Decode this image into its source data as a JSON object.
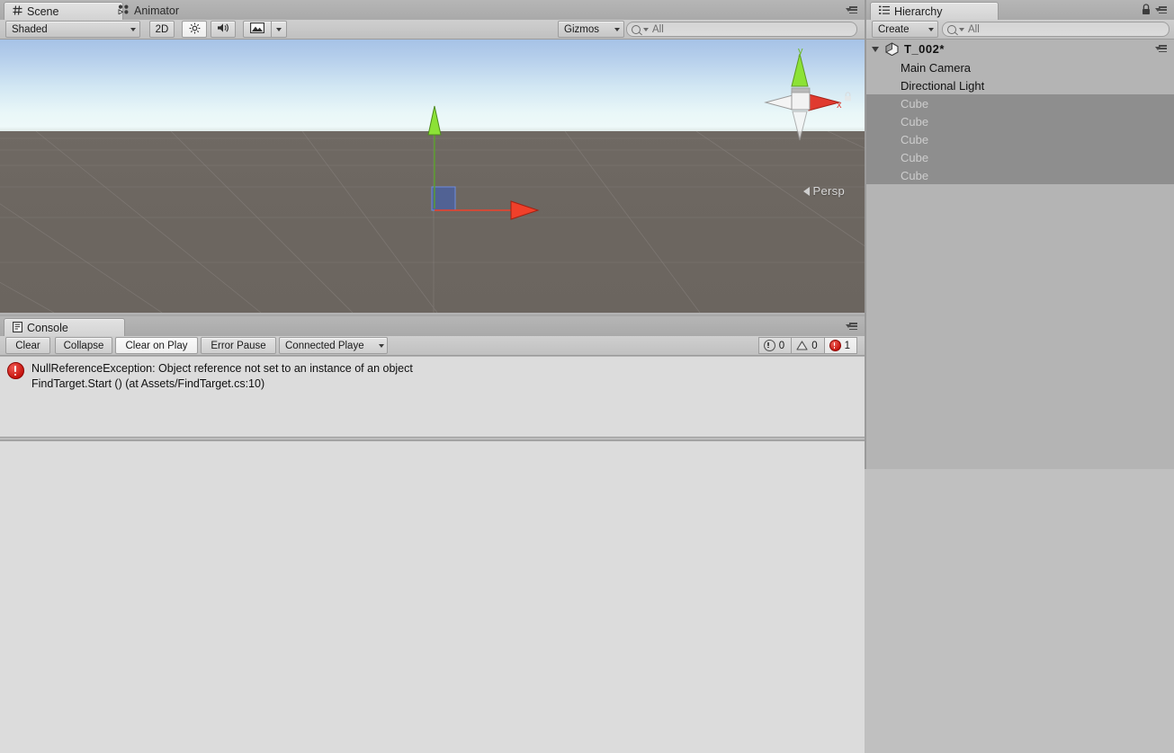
{
  "scene_panel": {
    "tabs": [
      {
        "label": "Scene",
        "icon": "grid-hash-icon",
        "active": true
      },
      {
        "label": "Animator",
        "icon": "animator-icon",
        "active": false
      }
    ],
    "toolbar": {
      "draw_mode": "Shaded",
      "two_d_label": "2D",
      "lighting_icon": "sun-icon",
      "audio_icon": "speaker-icon",
      "effects_icon": "image-icon",
      "gizmos_label": "Gizmos",
      "search_placeholder": "All",
      "search_value": "All",
      "menu_icon": "panel-menu-icon"
    },
    "viewport": {
      "camera_mode": "Persp",
      "gizmo_axes": [
        {
          "axis": "y",
          "label": "y",
          "color": "#7ed320"
        },
        {
          "axis": "x",
          "label": "x",
          "color": "#e03a2f"
        },
        {
          "axis": "z",
          "label": "",
          "color": "#e8e8e8"
        }
      ],
      "lock_icon": "lock-icon",
      "sky_top_color": "#a6c2e6",
      "sky_horizon_color": "#eef9f9",
      "ground_color": "#6d6761",
      "move_gizmo": {
        "y_axis_color": "#8ce236",
        "x_axis_color": "#f0402a",
        "z_plane_color": "#3a5fc0"
      }
    }
  },
  "console_panel": {
    "tabs": [
      {
        "label": "Console",
        "icon": "console-icon",
        "active": true
      }
    ],
    "toolbar": {
      "clear_label": "Clear",
      "collapse_label": "Collapse",
      "clear_on_play_label": "Clear on Play",
      "error_pause_label": "Error Pause",
      "connected_player_label": "Connected Playe",
      "clear_on_play_active": true
    },
    "counters": {
      "info_count": "0",
      "warning_count": "0",
      "error_count": "1",
      "error_active": true
    },
    "entries": [
      {
        "type": "error",
        "line1": "NullReferenceException: Object reference not set to an instance of an object",
        "line2": "FindTarget.Start () (at Assets/FindTarget.cs:10)"
      }
    ]
  },
  "hierarchy_panel": {
    "tabs": [
      {
        "label": "Hierarchy",
        "icon": "hierarchy-icon",
        "active": true
      }
    ],
    "lock_icon": "lock-icon",
    "menu_icon": "panel-menu-icon",
    "toolbar": {
      "create_label": "Create",
      "search_placeholder": "All",
      "search_value": "All"
    },
    "scene_root": {
      "label": "T_002*",
      "icon": "unity-scene-icon",
      "expanded": true
    },
    "items": [
      {
        "label": "Main Camera",
        "inactive": false
      },
      {
        "label": "Directional Light",
        "inactive": false
      },
      {
        "label": "Cube",
        "inactive": true
      },
      {
        "label": "Cube",
        "inactive": true
      },
      {
        "label": "Cube",
        "inactive": true
      },
      {
        "label": "Cube",
        "inactive": true
      },
      {
        "label": "Cube",
        "inactive": true
      }
    ]
  }
}
